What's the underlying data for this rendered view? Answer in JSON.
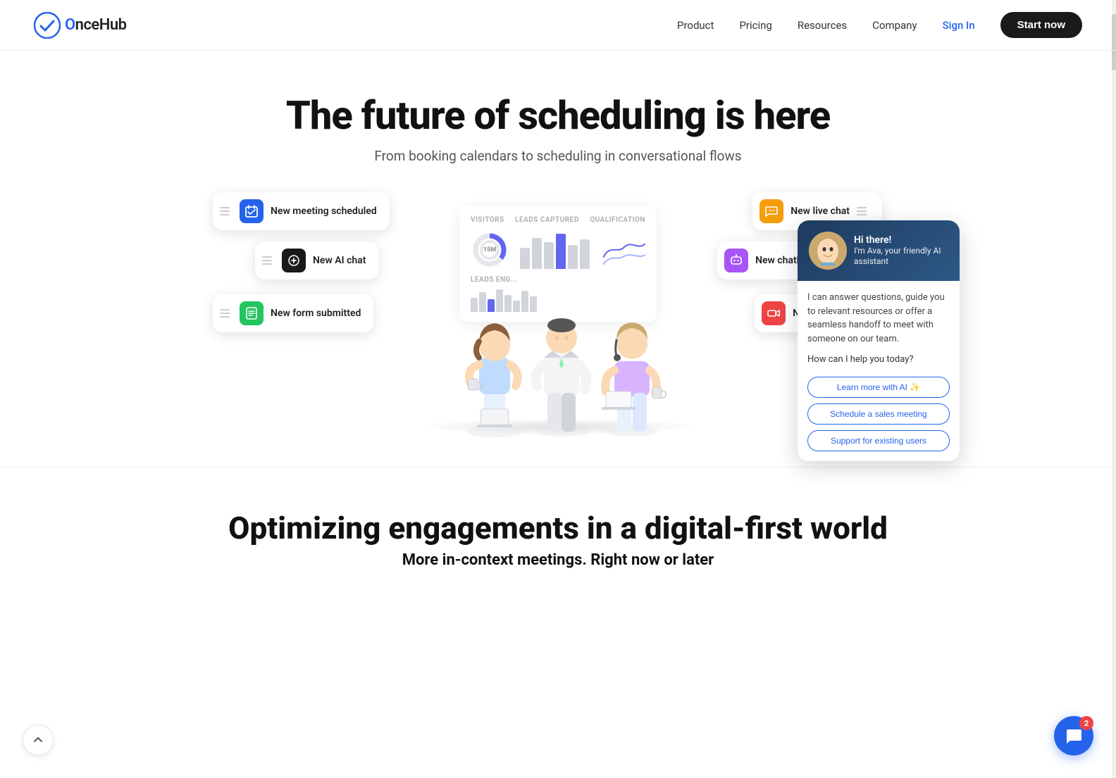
{
  "nav": {
    "logo_text": "nceHub",
    "links": [
      "Product",
      "Pricing",
      "Resources",
      "Company"
    ],
    "signin_label": "Sign In",
    "cta_label": "Start now"
  },
  "hero": {
    "title": "The future of scheduling is here",
    "subtitle": "From booking calendars to scheduling in conversational flows"
  },
  "pills": [
    {
      "id": "meeting",
      "label": "New meeting scheduled",
      "icon_color": "#2563eb",
      "icon": "✓"
    },
    {
      "id": "ai",
      "label": "New AI chat",
      "icon_color": "#1a1a1a",
      "icon": "✦"
    },
    {
      "id": "form",
      "label": "New form submitted",
      "icon_color": "#22c55e",
      "icon": "✓"
    },
    {
      "id": "livechat",
      "label": "New live chat",
      "icon_color": "#f59e0b",
      "icon": "💬"
    },
    {
      "id": "chatbot",
      "label": "New chatbot conversation",
      "icon_color": "#a855f7",
      "icon": "🤖"
    },
    {
      "id": "video",
      "label": "New video call",
      "icon_color": "#ef4444",
      "icon": "📹"
    }
  ],
  "chart": {
    "visitors_label": "VISITORS",
    "leads_label": "LEADS CAPTURED",
    "qual_label": "QUALIFICATION",
    "big_number": "15M",
    "leads_engaged": "LEADS ENG..."
  },
  "chatbot": {
    "greeting": "Hi there!",
    "name": "I'm Ava, your friendly AI assistant",
    "body": "I can answer questions, guide you to relevant resources or offer a seamless handoff to meet with someone on our team.",
    "question": "How can I help you today?",
    "buttons": [
      {
        "label": "Learn more with AI ✨"
      },
      {
        "label": "Schedule a sales meeting"
      },
      {
        "label": "Support for existing users"
      }
    ]
  },
  "chat_fab": {
    "badge": "2"
  },
  "bottom": {
    "title": "Optimizing engagements in a digital-first world",
    "subtitle": "More in-context meetings. Right now or later"
  }
}
